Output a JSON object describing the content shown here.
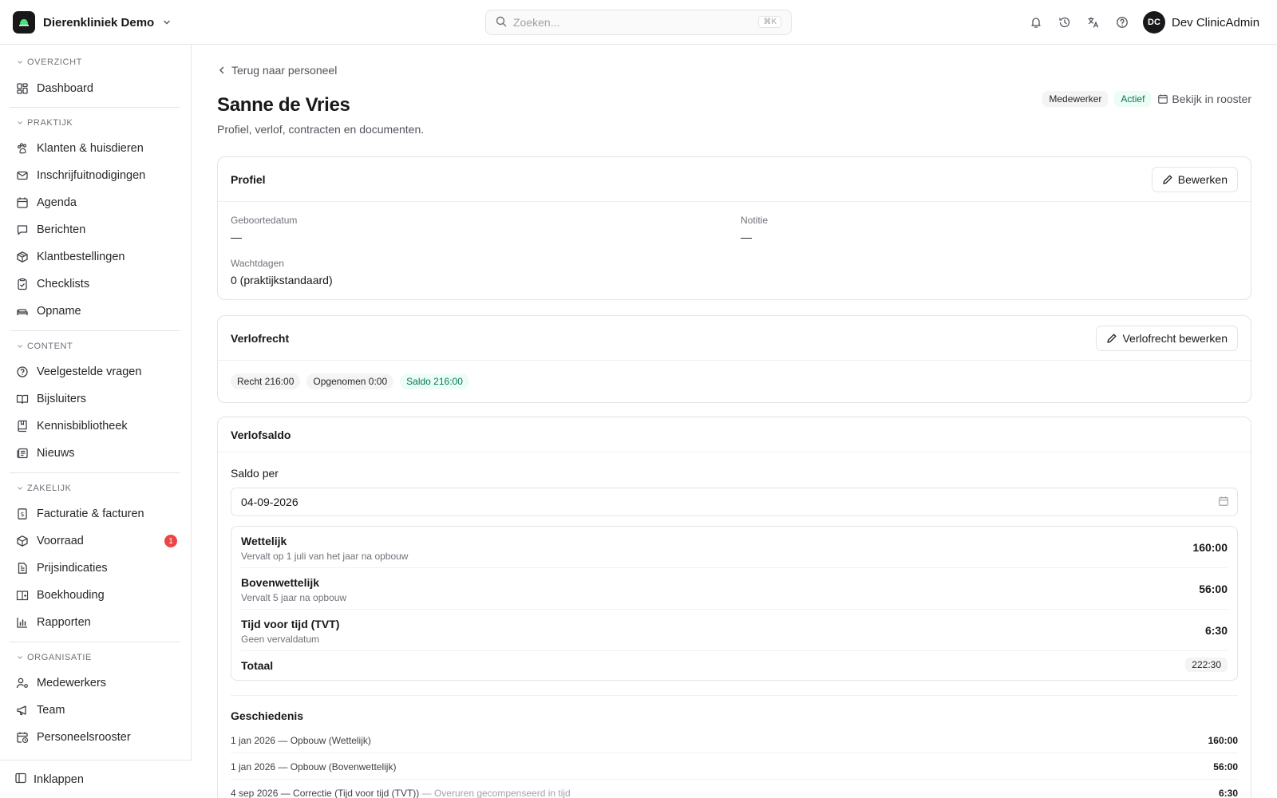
{
  "header": {
    "brand_name": "Dierenkliniek Demo",
    "search_placeholder": "Zoeken...",
    "search_shortcut": "⌘K",
    "user_initials": "DC",
    "user_name": "Dev ClinicAdmin"
  },
  "sidebar": {
    "sections": {
      "overzicht": "OVERZICHT",
      "praktijk": "PRAKTIJK",
      "content": "CONTENT",
      "zakelijk": "ZAKELIJK",
      "organisatie": "ORGANISATIE"
    },
    "items": {
      "dashboard": "Dashboard",
      "klanten": "Klanten & huisdieren",
      "inschrijf": "Inschrijfuitnodigingen",
      "agenda": "Agenda",
      "berichten": "Berichten",
      "klantbestellingen": "Klantbestellingen",
      "checklists": "Checklists",
      "opname": "Opname",
      "faq": "Veelgestelde vragen",
      "bijsluiters": "Bijsluiters",
      "kennis": "Kennisbibliotheek",
      "nieuws": "Nieuws",
      "facturatie": "Facturatie & facturen",
      "voorraad": "Voorraad",
      "prijs": "Prijsindicaties",
      "boekhouding": "Boekhouding",
      "rapporten": "Rapporten",
      "medewerkers": "Medewerkers",
      "team": "Team",
      "rooster": "Personeelsrooster"
    },
    "voorraad_badge": "1",
    "collapse_label": "Inklappen"
  },
  "page": {
    "back_label": "Terug naar personeel",
    "title": "Sanne de Vries",
    "subtitle": "Profiel, verlof, contracten en documenten.",
    "role_badge": "Medewerker",
    "status_badge": "Actief",
    "roster_link": "Bekijk in rooster"
  },
  "profile": {
    "title": "Profiel",
    "edit_label": "Bewerken",
    "birth_label": "Geboortedatum",
    "birth_value": "—",
    "note_label": "Notitie",
    "note_value": "—",
    "wait_label": "Wachtdagen",
    "wait_value": "0 (praktijkstandaard)"
  },
  "entitlement": {
    "title": "Verlofrecht",
    "edit_label": "Verlofrecht bewerken",
    "pill_right": "Recht 216:00",
    "pill_taken": "Opgenomen 0:00",
    "pill_balance": "Saldo 216:00"
  },
  "balance": {
    "title": "Verlofsaldo",
    "date_label": "Saldo per",
    "date_value": "04-09-2026",
    "rows": [
      {
        "name": "Wettelijk",
        "note": "Vervalt op 1 juli van het jaar na opbouw",
        "value": "160:00"
      },
      {
        "name": "Bovenwettelijk",
        "note": "Vervalt 5 jaar na opbouw",
        "value": "56:00"
      },
      {
        "name": "Tijd voor tijd (TVT)",
        "note": "Geen vervaldatum",
        "value": "6:30"
      }
    ],
    "total_label": "Totaal",
    "total_value": "222:30",
    "history_title": "Geschiedenis",
    "history": [
      {
        "text": "1 jan 2026 — Opbouw (Wettelijk)",
        "note": "",
        "value": "160:00"
      },
      {
        "text": "1 jan 2026 — Opbouw (Bovenwettelijk)",
        "note": "",
        "value": "56:00"
      },
      {
        "text": "4 sep 2026 — Correctie (Tijd voor tijd (TVT))",
        "note": " — Overuren gecompenseerd in tijd",
        "value": "6:30"
      }
    ]
  },
  "colors": {
    "accent_green": "#047857",
    "badge_red": "#ef4444",
    "text_dark": "#18181b"
  }
}
